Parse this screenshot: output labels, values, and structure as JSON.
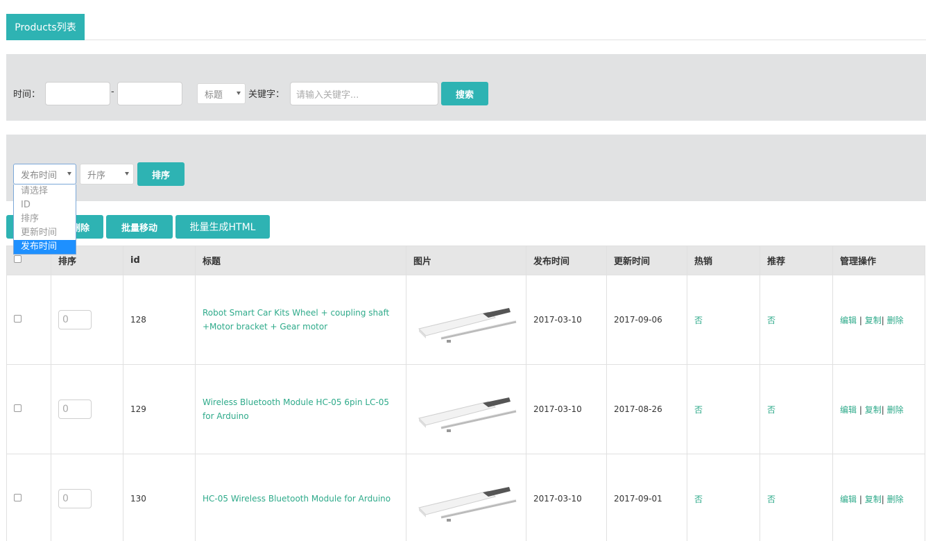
{
  "tab": {
    "label": "Products列表"
  },
  "search": {
    "time_label": "时间：",
    "date_separator": "-",
    "field_select": "标题",
    "keyword_label": "关键字：",
    "keyword_placeholder": "请输入关键字...",
    "search_button": "搜索"
  },
  "sort": {
    "field_select": "发布时间",
    "order_select": "升序",
    "sort_button": "排序",
    "dropdown_options": [
      "请选择",
      "ID",
      "排序",
      "更新时间",
      "发布时间"
    ],
    "dropdown_selected_index": 4
  },
  "batch": {
    "delete_button": "删除",
    "move_button": "批量移动",
    "html_button": "批量生成HTML"
  },
  "table": {
    "headers": [
      "",
      "排序",
      "id",
      "标题",
      "图片",
      "发布时间",
      "更新时间",
      "热销",
      "推荐",
      "管理操作"
    ],
    "rows": [
      {
        "order": "0",
        "id": "128",
        "title": "Robot Smart Car Kits Wheel + coupling shaft +Motor bracket + Gear motor",
        "published": "2017-03-10",
        "updated": "2017-09-06",
        "hot": "否",
        "recommend": "否",
        "edit": "编辑",
        "copy": "复制",
        "delete": "删除"
      },
      {
        "order": "0",
        "id": "129",
        "title": "Wireless Bluetooth Module HC-05 6pin LC-05 for Arduino",
        "published": "2017-03-10",
        "updated": "2017-08-26",
        "hot": "否",
        "recommend": "否",
        "edit": "编辑",
        "copy": "复制",
        "delete": "删除"
      },
      {
        "order": "0",
        "id": "130",
        "title": "HC-05 Wireless Bluetooth Module for Arduino",
        "published": "2017-03-10",
        "updated": "2017-09-01",
        "hot": "否",
        "recommend": "否",
        "edit": "编辑",
        "copy": "复制",
        "delete": "删除"
      }
    ],
    "separator": "|"
  },
  "colors": {
    "accent": "#2eb3b3",
    "link": "#2eaa8a",
    "panel_bg": "#e1e2e3"
  }
}
